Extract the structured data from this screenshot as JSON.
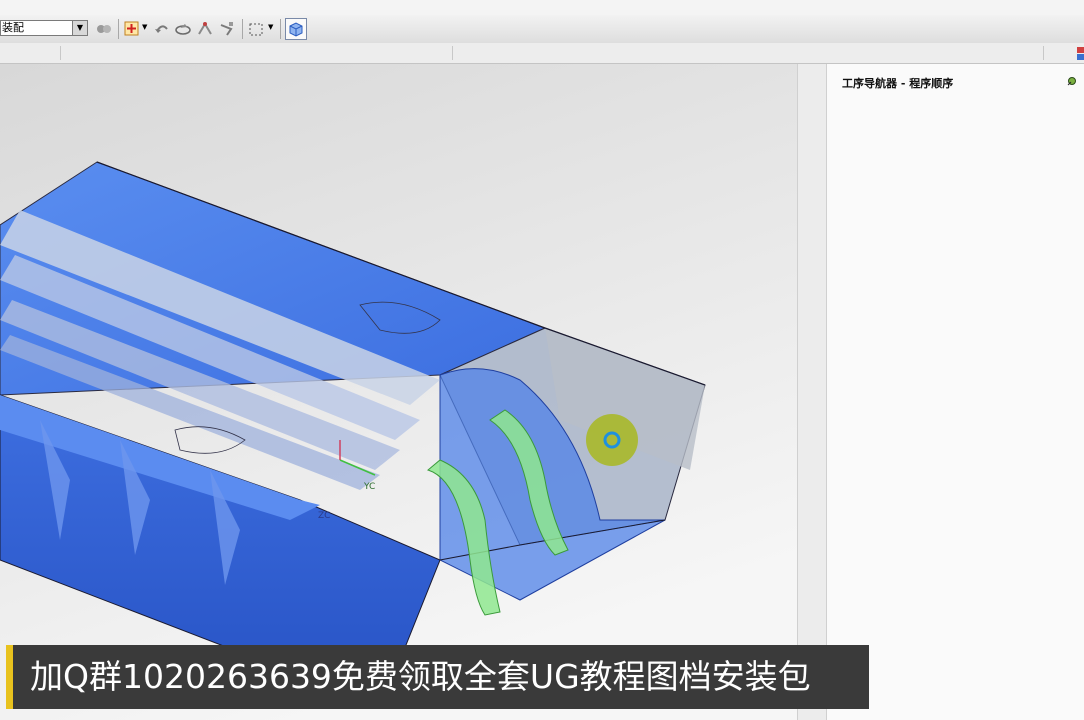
{
  "toolbar": {
    "filter_value": "装配"
  },
  "navigator": {
    "title": "工序导航器 - 程序顺序"
  },
  "viewport": {
    "axis_label_yc": "YC",
    "axis_label_zc": "ZC"
  },
  "caption": {
    "text": "加Q群1020263639免费领取全套UG教程图档安装包"
  },
  "colors": {
    "part_blue": "#3d6fe0",
    "toolpath_green": "#7fe07f",
    "caption_bg": "#3a3a3a",
    "caption_accent": "#e8c21e",
    "pivot_marker": "#a8b820"
  },
  "icons": [
    "chevron-down-icon",
    "assembly-icon",
    "snap-point-icon",
    "undo-icon",
    "rotate-icon",
    "measure-icon",
    "sketch-icon",
    "selection-box-icon",
    "cube-view-icon",
    "pin-icon"
  ]
}
